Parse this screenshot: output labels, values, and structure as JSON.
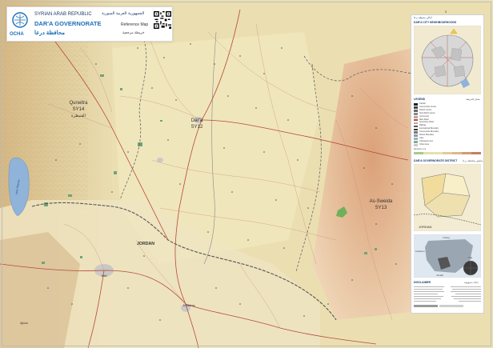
{
  "header": {
    "country_en": "SYRIAN ARAB REPUBLIC",
    "country_ar": "الجمهورية العربية السورية",
    "governorate_en": "DAR'A GOVERNORATE",
    "governorate_ar": "محافظة درعا",
    "map_type_en": "Reference Map",
    "map_type_ar": "خريطة مرجعية",
    "agency": "OCHA"
  },
  "map": {
    "labels": {
      "quneitra": "Quneitra",
      "quneitra_code": "SY14",
      "quneitra_ar": "القنيطرة",
      "dara": "Dar'a",
      "dara_code": "SY12",
      "as_sweida": "As-Sweida",
      "as_sweida_code": "SY13",
      "jordan": "JORDAN",
      "lake": "Lake Tiberias",
      "irbid": "Irbid",
      "al_mafraq": "Al Mafraq",
      "ajloun": "Ajloun"
    },
    "colors": {
      "terrain_base": "#e9ddb0",
      "terrain_relief": "#d9b98c",
      "sweida_shade": "#e8c0a0",
      "water": "#8fb3d9",
      "road_primary": "#b54a3a",
      "boundary": "#666666"
    }
  },
  "panel": {
    "page_no": "0",
    "title_ar": "أماكن محيطة درعا",
    "city_title": "DAR'A CITY NEIGHBOURHOODS",
    "legend_title": "LEGEND",
    "legend_title_ar": "مفتاح الخريطة",
    "legend_items": [
      {
        "label": "Capital",
        "color": "#222222"
      },
      {
        "label": "Governorate Centre",
        "color": "#444444"
      },
      {
        "label": "District Centre",
        "color": "#666666"
      },
      {
        "label": "Sub-district Centre",
        "color": "#888888"
      },
      {
        "label": "Community",
        "color": "#aaaaaa"
      },
      {
        "label": "Main Road",
        "color": "#b54a3a"
      },
      {
        "label": "Secondary Road",
        "color": "#d8a08a"
      },
      {
        "label": "Railway",
        "color": "#555555"
      },
      {
        "label": "International Boundary",
        "color": "#333333"
      },
      {
        "label": "Governorate Boundary",
        "color": "#777777"
      },
      {
        "label": "District Boundary",
        "color": "#999999"
      },
      {
        "label": "Lake",
        "color": "#8fb3d9"
      },
      {
        "label": "Cultivated Land",
        "color": "#7fb27f"
      },
      {
        "label": "Urban Area",
        "color": "#c9c9c9"
      }
    ],
    "elevation_label": "Elevation (m)",
    "district_title": "DAR'A GOVERNORATE DISTRICT",
    "district_title_ar": "مناطق محافظة درعا",
    "jordan_inset": "JORDAN",
    "location_labels": [
      "Turkey",
      "Iraq",
      "Jordan",
      "Lebanon"
    ],
    "disclaimer_title": "DISCLAIMER",
    "disclaimer_ar": "إخلاء مسؤولية"
  }
}
